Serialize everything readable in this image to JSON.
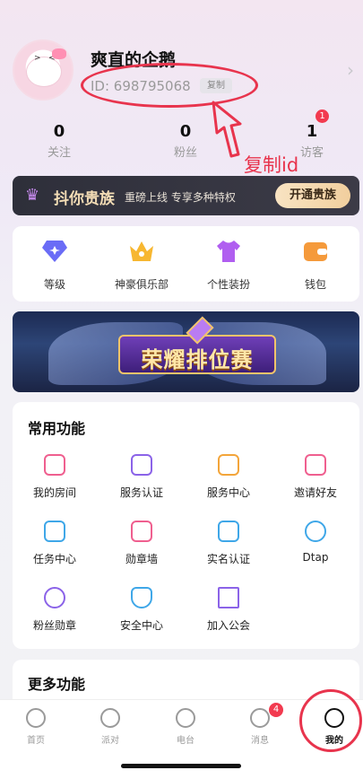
{
  "profile": {
    "nickname": "爽直的企鹅",
    "id_text": "ID: 698795068",
    "copy_label": "复制"
  },
  "annotation": {
    "text": "复制id",
    "color": "#e8344d"
  },
  "stats": [
    {
      "value": "0",
      "label": "关注"
    },
    {
      "value": "0",
      "label": "粉丝"
    },
    {
      "value": "1",
      "label": "访客",
      "badge": "1"
    }
  ],
  "vip": {
    "title": "抖你贵族",
    "subtitle": "重磅上线 专享多种特权",
    "button": "开通贵族"
  },
  "top_items": [
    {
      "label": "等级",
      "icon": "level-gem-icon",
      "color": "#6a6cf6"
    },
    {
      "label": "神豪俱乐部",
      "icon": "crown-icon",
      "color": "#f7b731"
    },
    {
      "label": "个性装扮",
      "icon": "tshirt-icon",
      "color": "#b05ef0"
    },
    {
      "label": "钱包",
      "icon": "wallet-icon",
      "color": "#f59a3b"
    }
  ],
  "promo": {
    "title": "荣耀排位赛"
  },
  "common": {
    "title": "常用功能",
    "items": [
      {
        "label": "我的房间",
        "icon": "room-icon",
        "color": "#ef5f8f"
      },
      {
        "label": "服务认证",
        "icon": "clipboard-check-icon",
        "color": "#8b63e8"
      },
      {
        "label": "服务中心",
        "icon": "document-icon",
        "color": "#f3a53a"
      },
      {
        "label": "邀请好友",
        "icon": "mail-icon",
        "color": "#ef5f8f"
      },
      {
        "label": "任务中心",
        "icon": "checklist-icon",
        "color": "#3fa7e8"
      },
      {
        "label": "勋章墙",
        "icon": "star-badge-icon",
        "color": "#ef5f8f"
      },
      {
        "label": "实名认证",
        "icon": "id-card-icon",
        "color": "#3fa7e8"
      },
      {
        "label": "Dtap",
        "icon": "lightning-icon",
        "color": "#3fa7e8"
      },
      {
        "label": "粉丝勋章",
        "icon": "hexagon-star-icon",
        "color": "#8b63e8"
      },
      {
        "label": "安全中心",
        "icon": "shield-check-icon",
        "color": "#3fa7e8"
      },
      {
        "label": "加入公会",
        "icon": "building-icon",
        "color": "#8b63e8"
      }
    ]
  },
  "more": {
    "title": "更多功能"
  },
  "tabs": [
    {
      "label": "首页",
      "icon": "compass-icon"
    },
    {
      "label": "派对",
      "icon": "smile-heart-icon"
    },
    {
      "label": "电台",
      "icon": "play-icon"
    },
    {
      "label": "消息",
      "icon": "chat-smile-icon",
      "badge": "4"
    },
    {
      "label": "我的",
      "icon": "glasses-face-icon",
      "active": true
    }
  ]
}
